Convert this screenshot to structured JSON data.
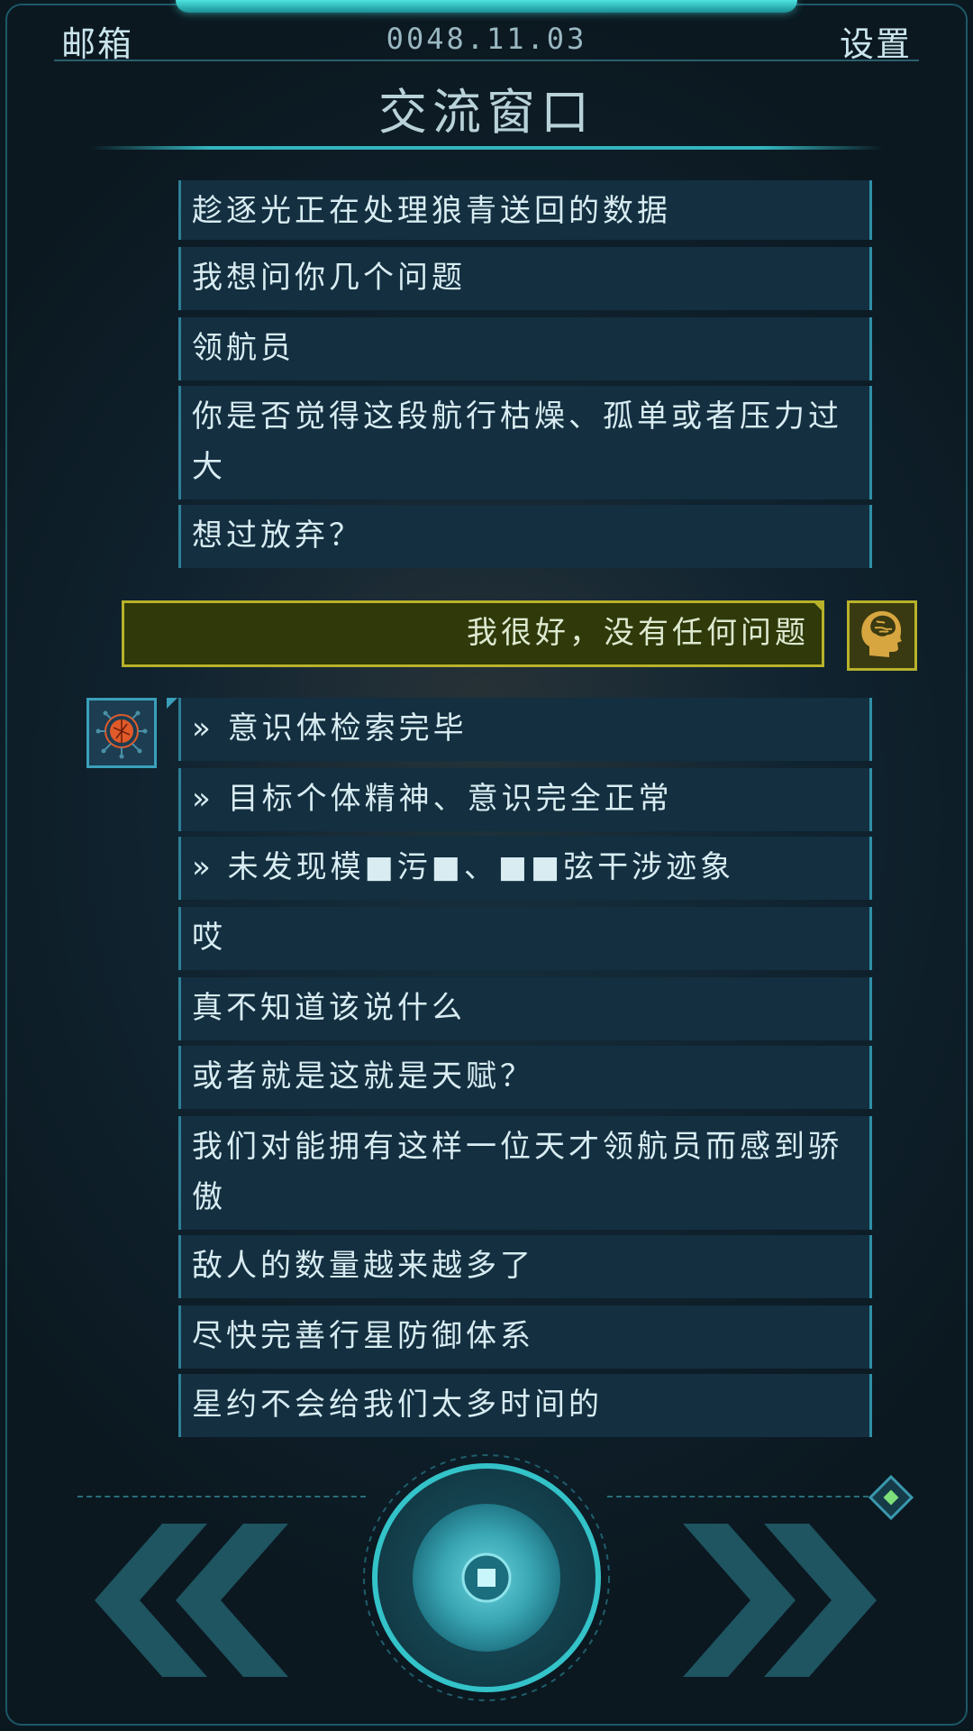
{
  "header": {
    "mailbox_label": "邮箱",
    "date": "0048.11.03",
    "settings_label": "设置",
    "title": "交流窗口"
  },
  "messages_top": [
    "趁逐光正在处理狼青送回的数据",
    "我想问你几个问题",
    "领航员",
    "你是否觉得这段航行枯燥、孤单或者压力过大",
    "想过放弃？"
  ],
  "reply": {
    "text": "我很好，没有任何问题"
  },
  "messages_bottom": [
    "» 意识体检索完毕",
    "» 目标个体精神、意识完全正常",
    "» 未发现模■污■、■■弦干涉迹象",
    "哎",
    "真不知道该说什么",
    "或者就是这就是天赋？",
    "我们对能拥有这样一位天才领航员而感到骄傲",
    "敌人的数量越来越多了",
    "尽快完善行星防御体系",
    "星约不会给我们太多时间的"
  ],
  "colors": {
    "accent_cyan": "#34b4be",
    "reply_border": "#b8b22a",
    "ai_core": "#e05a2a"
  },
  "icons": {
    "player_avatar": "brain-head-icon",
    "ai_avatar": "network-core-icon",
    "prev": "double-chevron-left-icon",
    "next": "double-chevron-right-icon",
    "center": "stop-square-icon",
    "corner": "diamond-icon"
  }
}
